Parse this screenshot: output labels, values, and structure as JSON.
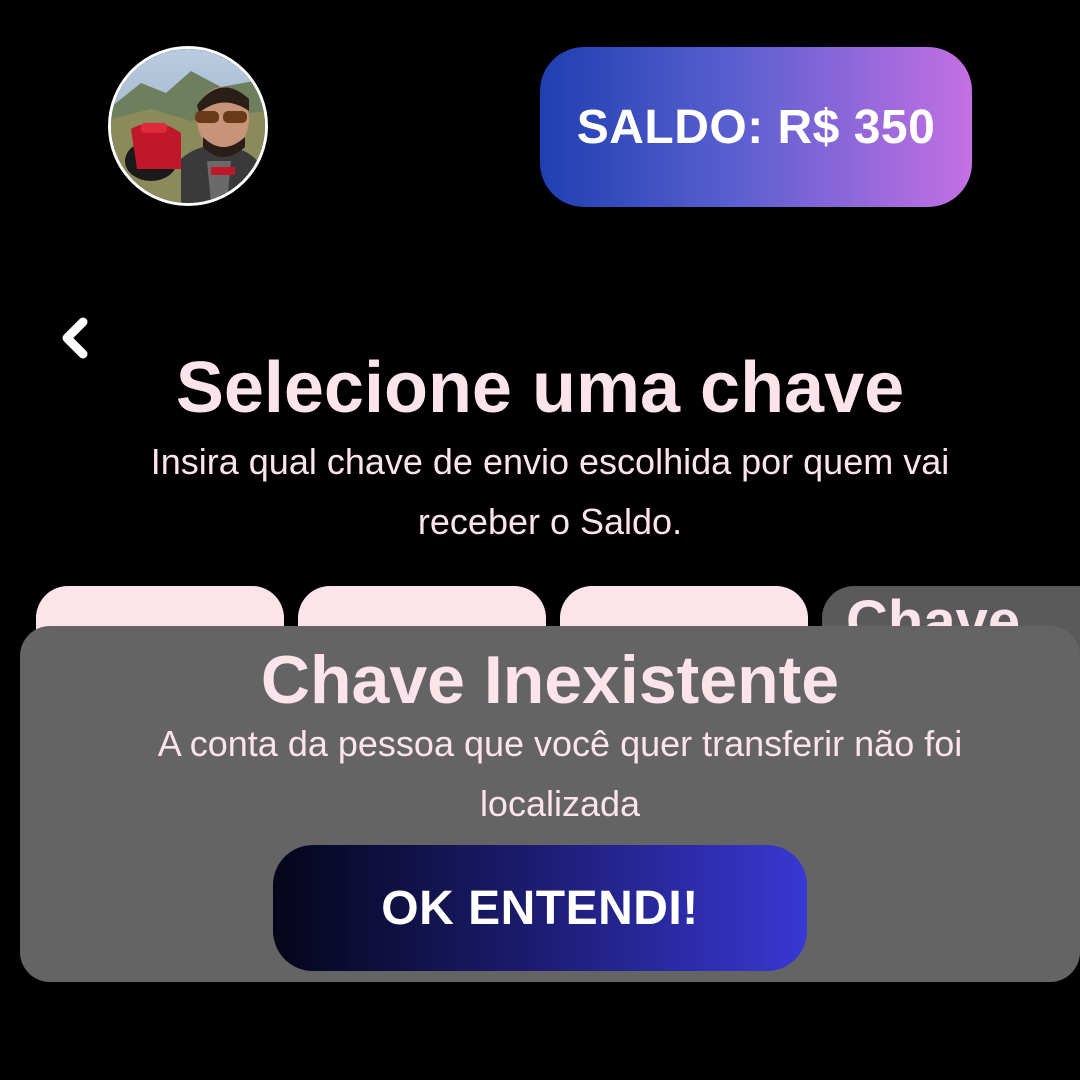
{
  "header": {
    "avatar_icon": "user-avatar-photo",
    "balance_label": "SALDO: R$ 350"
  },
  "page": {
    "back_icon": "chevron-left-icon",
    "title": "Selecione uma chave",
    "subtitle": "Insira qual chave de envio escolhida por quem vai receber o Saldo."
  },
  "key_options": {
    "visible_partial_label": "Chave"
  },
  "modal": {
    "title": "Chave Inexistente",
    "message": "A conta da pessoa que você quer  transferir não foi localizada",
    "button_label": "OK ENTENDI!"
  },
  "colors": {
    "background": "#000000",
    "text_pink": "#fde4ea",
    "modal_gray": "#646464",
    "balance_gradient_start": "#1f3fb0",
    "balance_gradient_end": "#c470e3",
    "button_gradient_start": "#05051a",
    "button_gradient_end": "#3838d4"
  }
}
